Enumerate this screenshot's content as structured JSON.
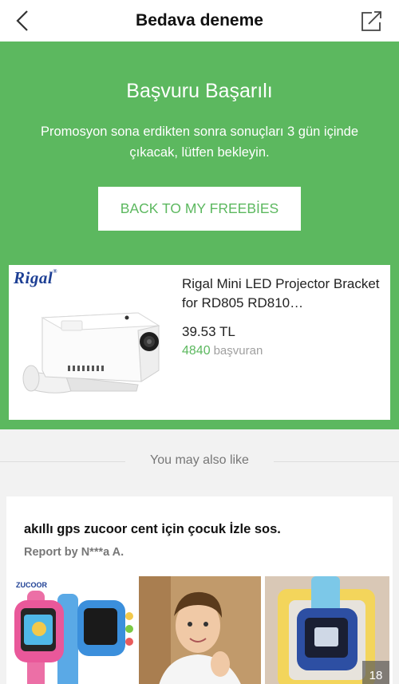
{
  "nav": {
    "title": "Bedava deneme"
  },
  "hero": {
    "title": "Başvuru Başarılı",
    "message": "Promosyon sona erdikten sonra sonuçları 3 gün içinde çıkacak, lütfen bekleyin.",
    "button_label": "BACK TO MY FREEBİES"
  },
  "product": {
    "brand": "Rigal",
    "brand_mark": "®",
    "name": "Rigal Mini LED Projector Bracket for RD805 RD810…",
    "price": "39.53 TL",
    "applicant_count": "4840",
    "applicant_label": "başvuran"
  },
  "recommendations": {
    "header": "You may also like",
    "item": {
      "title": "akıllı gps zucoor cent için çocuk İzle sos.",
      "report": "Report by N***a A.",
      "thumb_brand": "ZUCOOR",
      "photo_count": "18"
    }
  },
  "colors": {
    "accent_green": "#5cb85f",
    "brand_blue": "#1d3f94"
  }
}
